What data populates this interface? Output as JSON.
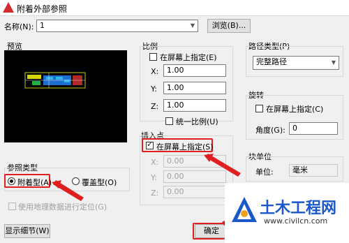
{
  "window": {
    "title": "附着外部参照"
  },
  "name_row": {
    "label": "名称(N):",
    "value": "1",
    "browse_button": "浏览(B)..."
  },
  "preview": {
    "label": "预览"
  },
  "scale": {
    "label": "比例",
    "on_screen_label": "在屏幕上指定(E)",
    "x_label": "X:",
    "x_value": "1.00",
    "y_label": "Y:",
    "y_value": "1.00",
    "z_label": "Z:",
    "z_value": "1.00",
    "uniform_label": "统一比例(U)"
  },
  "insert_point": {
    "label": "插入点",
    "on_screen_label": "在屏幕上指定(S)",
    "x_label": "X:",
    "x_value": "0.00",
    "y_label": "Y:",
    "y_value": "0.00",
    "z_label": "Z:",
    "z_value": "0.00"
  },
  "path_type": {
    "label": "路径类型(P)",
    "value": "完整路径"
  },
  "rotation": {
    "label": "旋转",
    "on_screen_label": "在屏幕上指定(C)",
    "angle_label": "角度(G):",
    "angle_value": "0"
  },
  "block_unit": {
    "label": "块单位",
    "unit_label": "单位:",
    "unit_value": "毫米"
  },
  "reference_type": {
    "label": "参照类型",
    "attach_label": "附着型(A)",
    "overlay_label": "覆盖型(O)"
  },
  "geo_label": "使用地理数据进行定位(G)",
  "details_button": "显示细节(W)",
  "ok_button": "确定",
  "watermark": {
    "title": "土木工程网",
    "url": "www.civilcn.com"
  },
  "colors": {
    "highlight": "#e02020",
    "watermark_title": "#1a57c9"
  }
}
